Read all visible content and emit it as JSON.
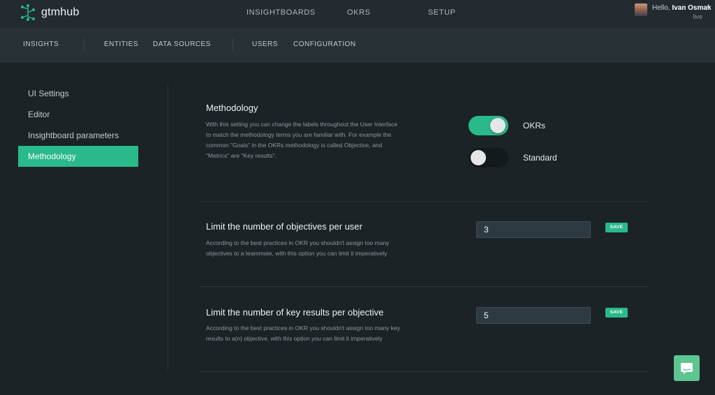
{
  "app": {
    "brand": "gtmhub"
  },
  "topnav": {
    "items": [
      "INSIGHTBOARDS",
      "OKRS",
      "SETUP"
    ]
  },
  "user": {
    "greeting": "Hello, ",
    "name": "Ivan Osmak",
    "env": "live"
  },
  "subnav": {
    "items": [
      "INSIGHTS",
      "ENTITIES",
      "DATA SOURCES",
      "USERS",
      "CONFIGURATION"
    ]
  },
  "sidebar": {
    "items": [
      {
        "label": "UI Settings"
      },
      {
        "label": "Editor"
      },
      {
        "label": "Insightboard parameters"
      },
      {
        "label": "Methodology",
        "active": true
      }
    ]
  },
  "methodology": {
    "title": "Methodology",
    "desc_lines": [
      "With this setting you can change the labels throughout the User Interface",
      "to match the methodology terms you are familiar with. For example the",
      "common \"Goals\" in the OKRs methodology is called Objective, and",
      "\"Metrics\" are \"Key results\"."
    ],
    "options": [
      {
        "label": "OKRs",
        "on": true
      },
      {
        "label": "Standard",
        "on": false
      }
    ]
  },
  "limit_objectives": {
    "title": "Limit the number of objectives per user",
    "desc_lines": [
      "According to the best practices in OKR you shouldn't assign too many",
      "objectives to a teammate, with this option you can limit it imperatively"
    ],
    "value": "3",
    "save_label": "SAVE"
  },
  "limit_key_results": {
    "title": "Limit the number of key results per objective",
    "desc_lines": [
      "According to the best practices in OKR you shouldn't assign too many key",
      "results to a(n) objective, with this option you can limit it imperatively"
    ],
    "value": "5",
    "save_label": "SAVE"
  },
  "colors": {
    "accent": "#2ab98a",
    "background": "#1c2327",
    "topbar": "#232b30",
    "subnav": "#273136",
    "chat": "#5cc590"
  },
  "icons": {
    "logo": "gtmhub-tree-logo-icon",
    "chat": "chat-bubble-icon",
    "dropdown": "caret-down-icon"
  }
}
